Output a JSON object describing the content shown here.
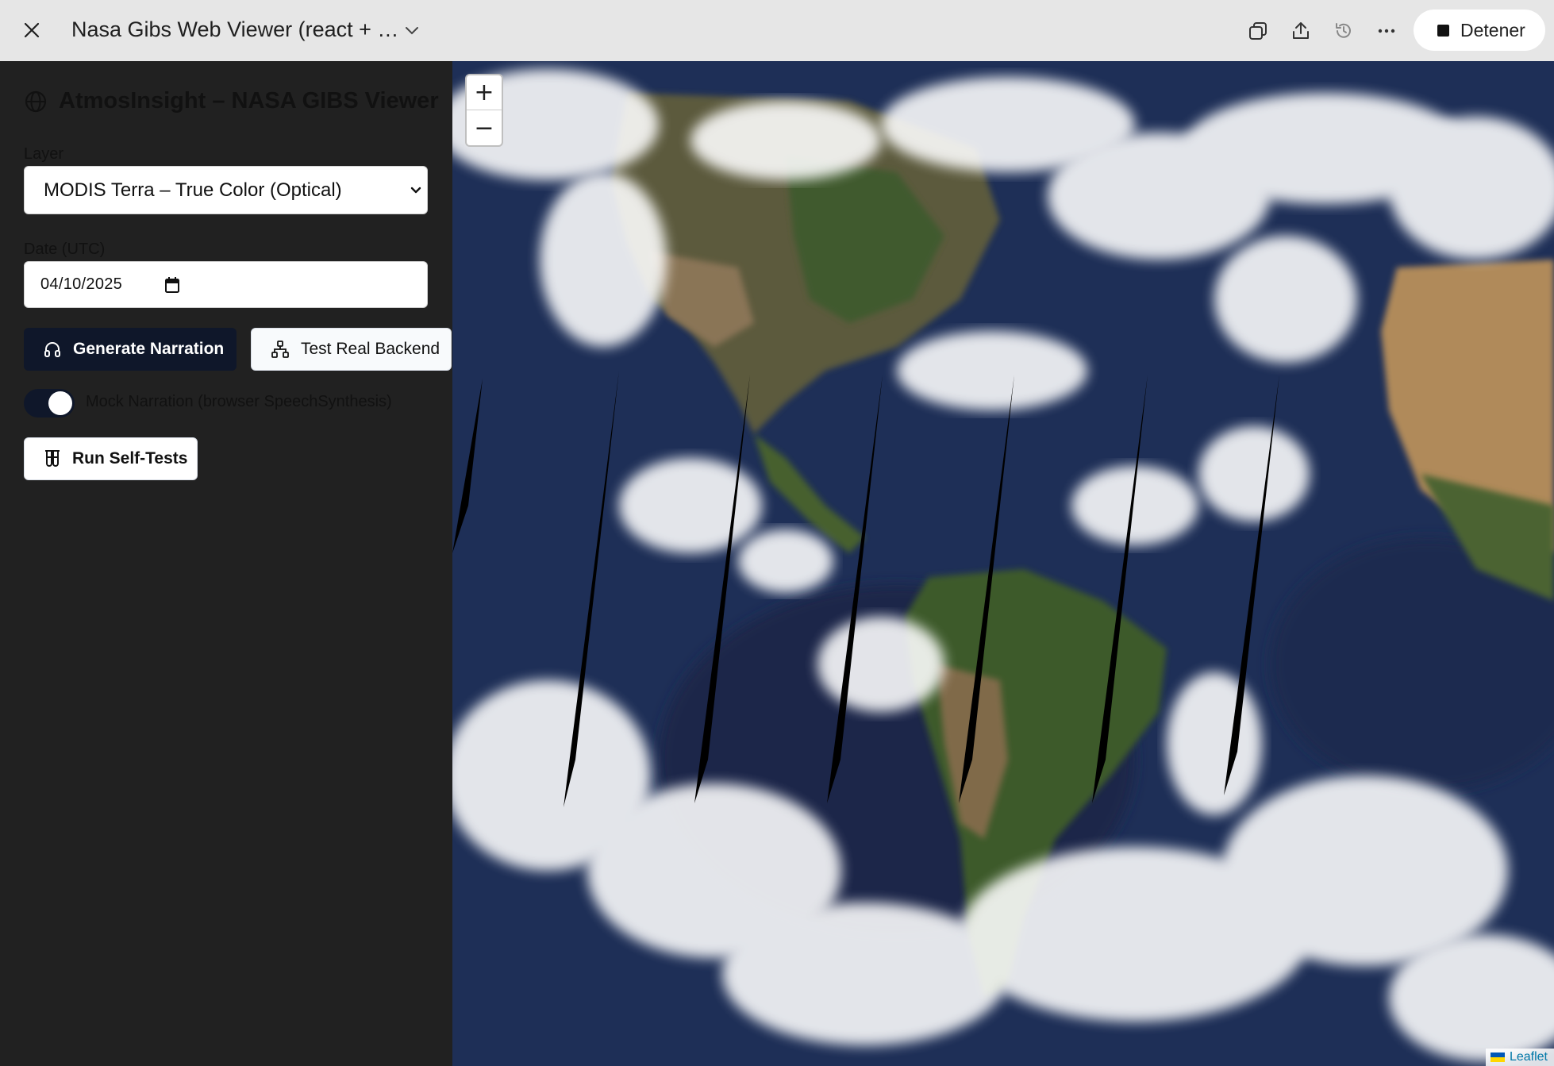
{
  "topbar": {
    "title": "Nasa Gibs Web Viewer (react + …",
    "stop_label": "Detener",
    "icons": [
      "close-icon",
      "chevron-down-icon",
      "copy-icon",
      "share-icon",
      "history-icon",
      "more-icon",
      "stop-icon"
    ]
  },
  "sidebar": {
    "title": "AtmosInsight – NASA GIBS Viewer",
    "layer_label": "Layer",
    "layer_value": "MODIS Terra – True Color (Optical)",
    "date_label": "Date (UTC)",
    "date_value": "04/10/2025",
    "generate_label": "Generate Narration",
    "test_backend_label": "Test Real Backend",
    "mock_toggle_label": "Mock Narration (browser SpeechSynthesis)",
    "mock_toggle_on": true,
    "self_tests_label": "Run Self-Tests"
  },
  "map": {
    "zoom_in": "+",
    "zoom_out": "−",
    "attribution": "Leaflet"
  },
  "colors": {
    "topbar_bg": "#e6e6e6",
    "sidebar_bg": "#212121",
    "primary_button": "#0f172a",
    "ocean": "#1d2e55",
    "link": "#0078a8"
  }
}
